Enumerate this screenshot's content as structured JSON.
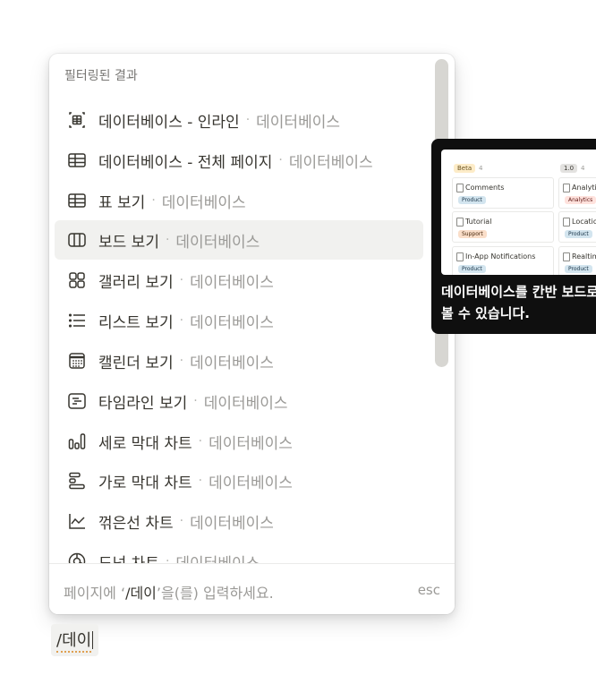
{
  "menu": {
    "section_label": "필터링된 결과",
    "items": [
      {
        "title": "데이터베이스 - 인라인",
        "sub": "데이터베이스",
        "icon": "inline-database-icon"
      },
      {
        "title": "데이터베이스 - 전체 페이지",
        "sub": "데이터베이스",
        "icon": "table-icon"
      },
      {
        "title": "표 보기",
        "sub": "데이터베이스",
        "icon": "table-icon"
      },
      {
        "title": "보드 보기",
        "sub": "데이터베이스",
        "icon": "board-icon"
      },
      {
        "title": "갤러리 보기",
        "sub": "데이터베이스",
        "icon": "gallery-icon"
      },
      {
        "title": "리스트 보기",
        "sub": "데이터베이스",
        "icon": "list-icon"
      },
      {
        "title": "캘린더 보기",
        "sub": "데이터베이스",
        "icon": "calendar-icon"
      },
      {
        "title": "타임라인 보기",
        "sub": "데이터베이스",
        "icon": "timeline-icon"
      },
      {
        "title": "세로 막대 차트",
        "sub": "데이터베이스",
        "icon": "vertical-bar-chart-icon"
      },
      {
        "title": "가로 막대 차트",
        "sub": "데이터베이스",
        "icon": "horizontal-bar-chart-icon"
      },
      {
        "title": "꺾은선 차트",
        "sub": "데이터베이스",
        "icon": "line-chart-icon"
      },
      {
        "title": "도넛 차트",
        "sub": "데이터베이스",
        "icon": "donut-chart-icon"
      }
    ],
    "separator": "·",
    "selected_index": 3
  },
  "footer": {
    "hint_prefix": "페이지에 ‘",
    "hint_query": "/데이",
    "hint_suffix": "’을(를) 입력하세요.",
    "esc_label": "esc"
  },
  "editor": {
    "typed_text": "/데이"
  },
  "tooltip": {
    "caption": "데이터베이스를 칸반 보드로 볼 수 있습니다.",
    "preview": {
      "col1_tag": "Beta",
      "col1_count": "4",
      "col2_tag": "1.0",
      "col2_count": "4",
      "cards": [
        {
          "title": "Comments",
          "tag": "Product"
        },
        {
          "title": "Analytics",
          "tag": "Analytics"
        },
        {
          "title": "Tutorial",
          "tag": "Support"
        },
        {
          "title": "Location",
          "tag": "Product"
        },
        {
          "title": "In-App Notifications",
          "tag": "Product"
        },
        {
          "title": "Realtime",
          "tag": "Product"
        }
      ]
    }
  },
  "colors": {
    "selected_bg": "#f1f1ef",
    "text": "#37352f",
    "muted": "#9b9a97",
    "tooltip_bg": "#0f0f0f"
  }
}
